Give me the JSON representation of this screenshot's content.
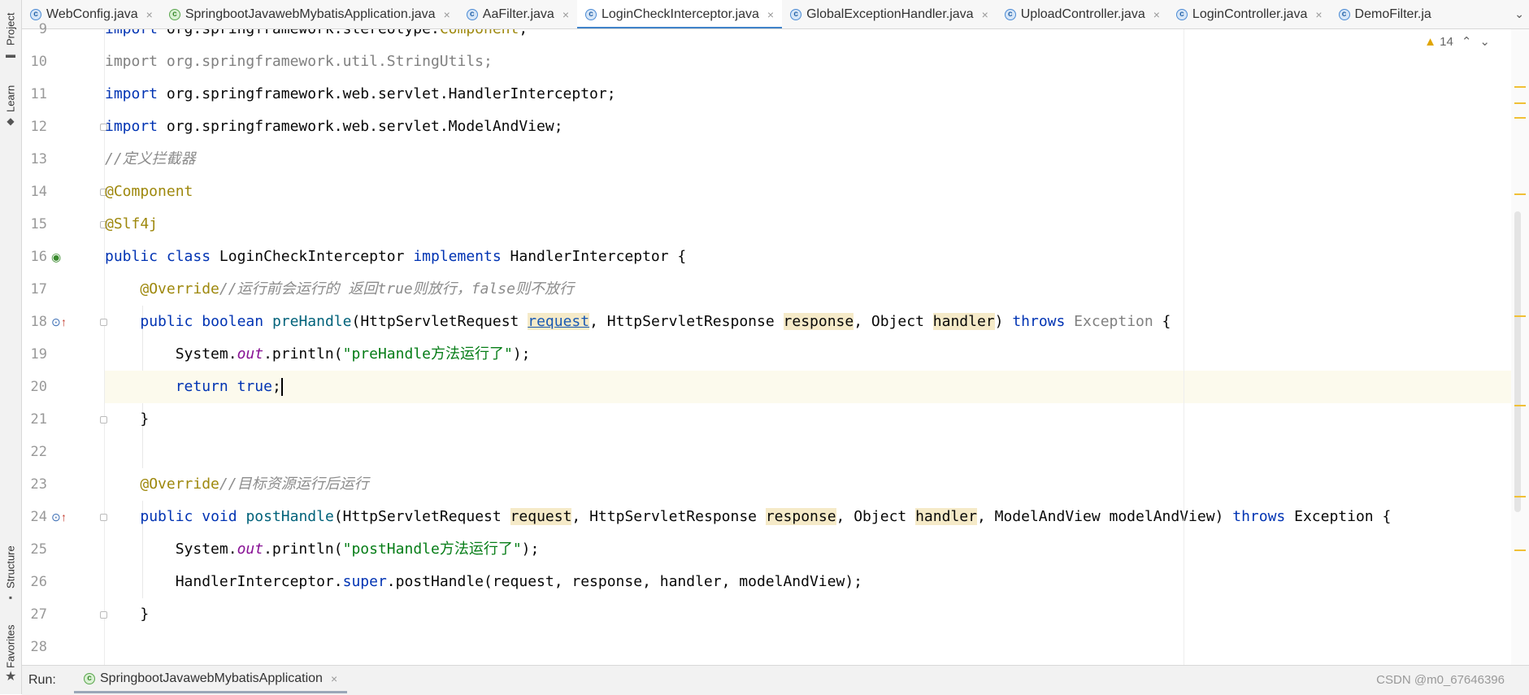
{
  "toolwindows": {
    "project": "Project",
    "learn": "Learn",
    "structure": "Structure",
    "favorites": "Favorites"
  },
  "tabs": [
    {
      "label": "WebConfig.java",
      "icon": "c",
      "active": false
    },
    {
      "label": "SpringbootJavawebMybatisApplication.java",
      "icon": "spring",
      "active": false
    },
    {
      "label": "AaFilter.java",
      "icon": "c",
      "active": false
    },
    {
      "label": "LoginCheckInterceptor.java",
      "icon": "c",
      "active": true
    },
    {
      "label": "GlobalExceptionHandler.java",
      "icon": "c",
      "active": false
    },
    {
      "label": "UploadController.java",
      "icon": "c",
      "active": false
    },
    {
      "label": "LoginController.java",
      "icon": "c",
      "active": false
    },
    {
      "label": "DemoFilter.ja",
      "icon": "c",
      "active": false
    }
  ],
  "inspections": {
    "warning_count": "14"
  },
  "editor": {
    "line_numbers": [
      "9",
      "10",
      "11",
      "12",
      "13",
      "14",
      "15",
      "16",
      "17",
      "18",
      "19",
      "20",
      "21",
      "22",
      "23",
      "24",
      "25",
      "26",
      "27",
      "28"
    ],
    "l9": {
      "kw": "import",
      "pkg": " org.springframework.stereotype.",
      "cls": "Component",
      "end": ";"
    },
    "l10": {
      "text": "import org.springframework.util.StringUtils;"
    },
    "l11": {
      "kw": "import",
      "rest": " org.springframework.web.servlet.HandlerInterceptor;"
    },
    "l12": {
      "kw": "import",
      "rest": " org.springframework.web.servlet.ModelAndView;"
    },
    "l13": {
      "comment": "//定义拦截器"
    },
    "l14": {
      "ann": "@Component"
    },
    "l15": {
      "ann": "@Slf4j"
    },
    "l16": {
      "kw1": "public",
      "kw2": "class",
      "name": " LoginCheckInterceptor ",
      "kw3": "implements",
      "rest": " HandlerInterceptor {"
    },
    "l17": {
      "ann": "@Override",
      "comment": "//运行前会运行的 返回true则放行，false则不放行"
    },
    "l18": {
      "kw1": "public",
      "kw2": "boolean",
      "fn": "preHandle",
      "t1": "(HttpServletRequest ",
      "p1": "request",
      "t2": ", HttpServletResponse ",
      "p2": "response",
      "t3": ", Object ",
      "p3": "handler",
      "t4": ") ",
      "kw3": "throws",
      "exc": " Exception",
      "end": " {"
    },
    "l19": {
      "pre": "System.",
      "stat": "out",
      "mid": ".println(",
      "str": "\"preHandle方法运行了\"",
      "end": ");"
    },
    "l20": {
      "kw1": "return",
      "kw2": "true",
      "end": ";"
    },
    "l21": {
      "text": "}"
    },
    "l23": {
      "ann": "@Override",
      "comment": "//目标资源运行后运行"
    },
    "l24": {
      "kw1": "public",
      "kw2": "void",
      "fn": "postHandle",
      "t1": "(HttpServletRequest ",
      "p1": "request",
      "t2": ", HttpServletResponse ",
      "p2": "response",
      "t3": ", Object ",
      "p3": "handler",
      "t4": ", ModelAndView modelAndView) ",
      "kw3": "throws",
      "end": " Exception {"
    },
    "l25": {
      "pre": "System.",
      "stat": "out",
      "mid": ".println(",
      "str": "\"postHandle方法运行了\"",
      "end": ");"
    },
    "l26": {
      "pre": "HandlerInterceptor.",
      "kw": "super",
      "rest": ".postHandle(request, response, handler, modelAndView);"
    },
    "l27": {
      "text": "}"
    }
  },
  "runbar": {
    "label": "Run:",
    "tab": "SpringbootJavawebMybatisApplication",
    "watermark": "CSDN @m0_67646396"
  }
}
